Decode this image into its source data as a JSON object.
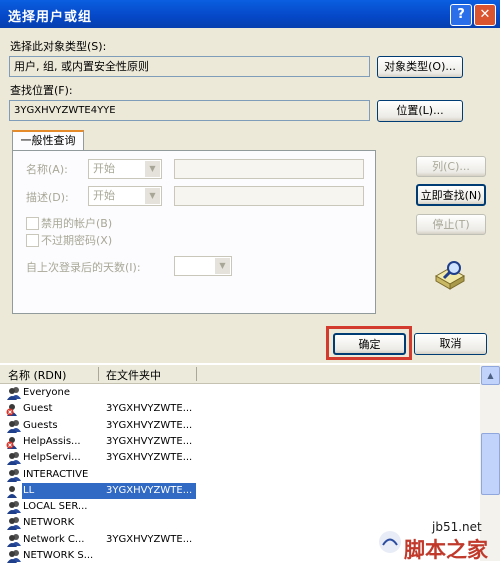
{
  "window": {
    "title": "选择用户或组",
    "help_label": "?",
    "close_label": "✕"
  },
  "object_type": {
    "label": "选择此对象类型(S):",
    "value": "用户, 组, 或内置安全性原则",
    "button": "对象类型(O)..."
  },
  "location": {
    "label": "查找位置(F):",
    "value": "3YGXHVYZWTE4YYE",
    "button": "位置(L)..."
  },
  "tab": {
    "label": "一般性查询"
  },
  "query": {
    "name_label": "名称(A):",
    "name_mode": "开始",
    "desc_label": "描述(D):",
    "desc_mode": "开始",
    "disabled_accounts": "禁用的帐户(B)",
    "nonexpiring_pwd": "不过期密码(X)",
    "days_since_logon": "自上次登录后的天数(I):"
  },
  "side_buttons": {
    "columns": "列(C)...",
    "find_now": "立即查找(N)",
    "stop": "停止(T)"
  },
  "icons": {
    "search": "search-icon",
    "user": "user-icon",
    "user_disabled": "user-disabled-icon",
    "group": "group-icon"
  },
  "dialog_buttons": {
    "ok": "确定",
    "cancel": "取消"
  },
  "results": {
    "headers": [
      "名称 (RDN)",
      "在文件夹中"
    ],
    "rows": [
      {
        "name": "Everyone",
        "folder": "",
        "icon": "group-icon"
      },
      {
        "name": "Guest",
        "folder": "3YGXHVYZWTE...",
        "icon": "user-disabled-icon"
      },
      {
        "name": "Guests",
        "folder": "3YGXHVYZWTE...",
        "icon": "group-icon"
      },
      {
        "name": "HelpAssis...",
        "folder": "3YGXHVYZWTE...",
        "icon": "user-disabled-icon"
      },
      {
        "name": "HelpServi...",
        "folder": "3YGXHVYZWTE...",
        "icon": "group-icon"
      },
      {
        "name": "INTERACTIVE",
        "folder": "",
        "icon": "group-icon"
      },
      {
        "name": "LL",
        "folder": "3YGXHVYZWTE...",
        "icon": "user-icon",
        "selected": true
      },
      {
        "name": "LOCAL SER...",
        "folder": "",
        "icon": "group-icon"
      },
      {
        "name": "NETWORK",
        "folder": "",
        "icon": "group-icon"
      },
      {
        "name": "Network C...",
        "folder": "3YGXHVYZWTE...",
        "icon": "group-icon"
      },
      {
        "name": "NETWORK S...",
        "folder": "",
        "icon": "group-icon"
      }
    ]
  },
  "watermark": {
    "url": "jb51.net",
    "text": "脚本之家"
  },
  "colors": {
    "highlight_box": "#d23b2e",
    "selection": "#316ac5",
    "title_bar": "#0a5fe0"
  }
}
